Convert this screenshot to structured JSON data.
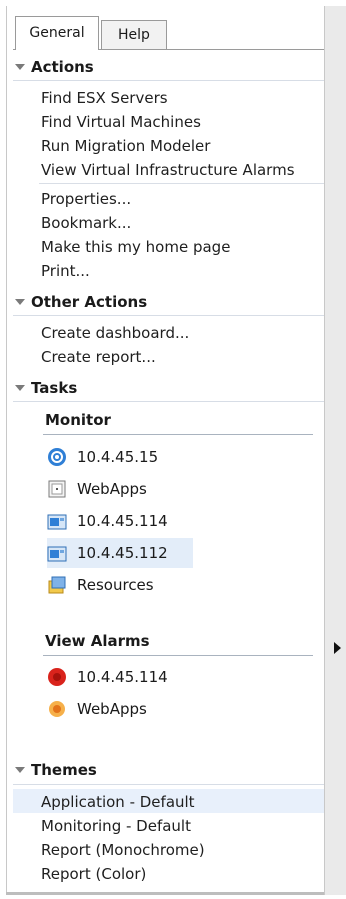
{
  "tabs": [
    {
      "label": "General"
    },
    {
      "label": "Help"
    }
  ],
  "actions": {
    "header": "Actions",
    "items": [
      {
        "label": "Find ESX Servers"
      },
      {
        "label": "Find Virtual Machines"
      },
      {
        "label": "Run Migration Modeler"
      },
      {
        "label": "View Virtual Infrastructure Alarms"
      },
      {
        "label": "Properties..."
      },
      {
        "label": "Bookmark..."
      },
      {
        "label": "Make this my home page"
      },
      {
        "label": "Print..."
      }
    ]
  },
  "other_actions": {
    "header": "Other Actions",
    "items": [
      {
        "label": "Create dashboard..."
      },
      {
        "label": "Create report..."
      }
    ]
  },
  "tasks": {
    "header": "Tasks",
    "monitor": {
      "title": "Monitor",
      "items": [
        {
          "label": "10.4.45.15",
          "icon": "vcenter-icon"
        },
        {
          "label": "WebApps",
          "icon": "application-icon"
        },
        {
          "label": "10.4.45.114",
          "icon": "host-icon"
        },
        {
          "label": "10.4.45.112",
          "icon": "host-icon"
        },
        {
          "label": "Resources",
          "icon": "resources-icon"
        }
      ]
    },
    "view_alarms": {
      "title": "View Alarms",
      "items": [
        {
          "label": "10.4.45.114",
          "icon": "critical-alarm-icon",
          "color": "#d9231c"
        },
        {
          "label": "WebApps",
          "icon": "warning-alarm-icon",
          "color": "#f08a1c"
        }
      ]
    }
  },
  "themes": {
    "header": "Themes",
    "items": [
      {
        "label": "Application - Default"
      },
      {
        "label": "Monitoring - Default"
      },
      {
        "label": "Report (Monochrome)"
      },
      {
        "label": "Report (Color)"
      }
    ]
  },
  "colors": {
    "selection": "#e3edf9",
    "accent_blue": "#2f7fd6"
  }
}
